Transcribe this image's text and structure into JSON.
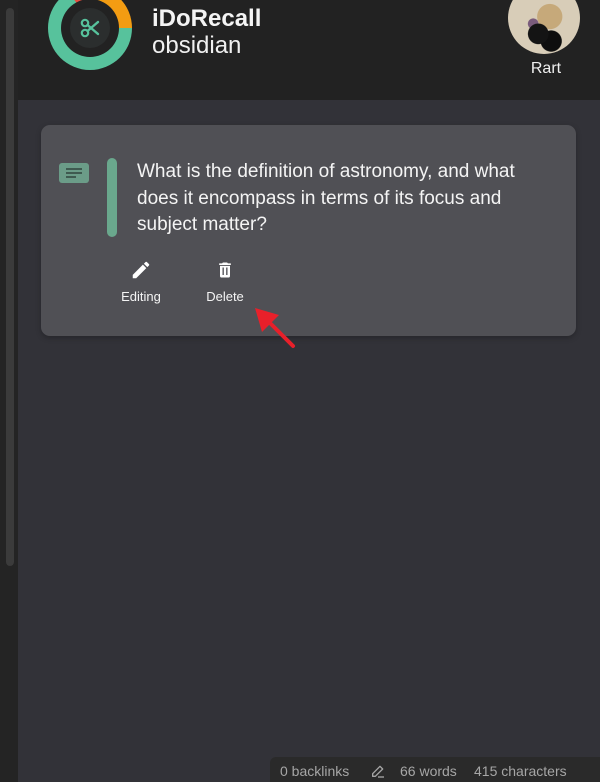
{
  "app": {
    "title": "iDoRecall",
    "subtitle": "obsidian"
  },
  "user": {
    "name": "Rart"
  },
  "card": {
    "question": "What is the definition of astronomy, and what does it encompass in terms of its focus and subject matter?",
    "actions": {
      "edit_label": "Editing",
      "delete_label": "Delete"
    },
    "accent_color": "#6aa88d"
  },
  "statusbar": {
    "backlinks": "0 backlinks",
    "words": "66 words",
    "characters": "415 characters"
  },
  "colors": {
    "logo_green": "#57c29c",
    "logo_orange": "#f39c12",
    "logo_red": "#e84e40",
    "annotation_arrow": "#e8202a"
  }
}
